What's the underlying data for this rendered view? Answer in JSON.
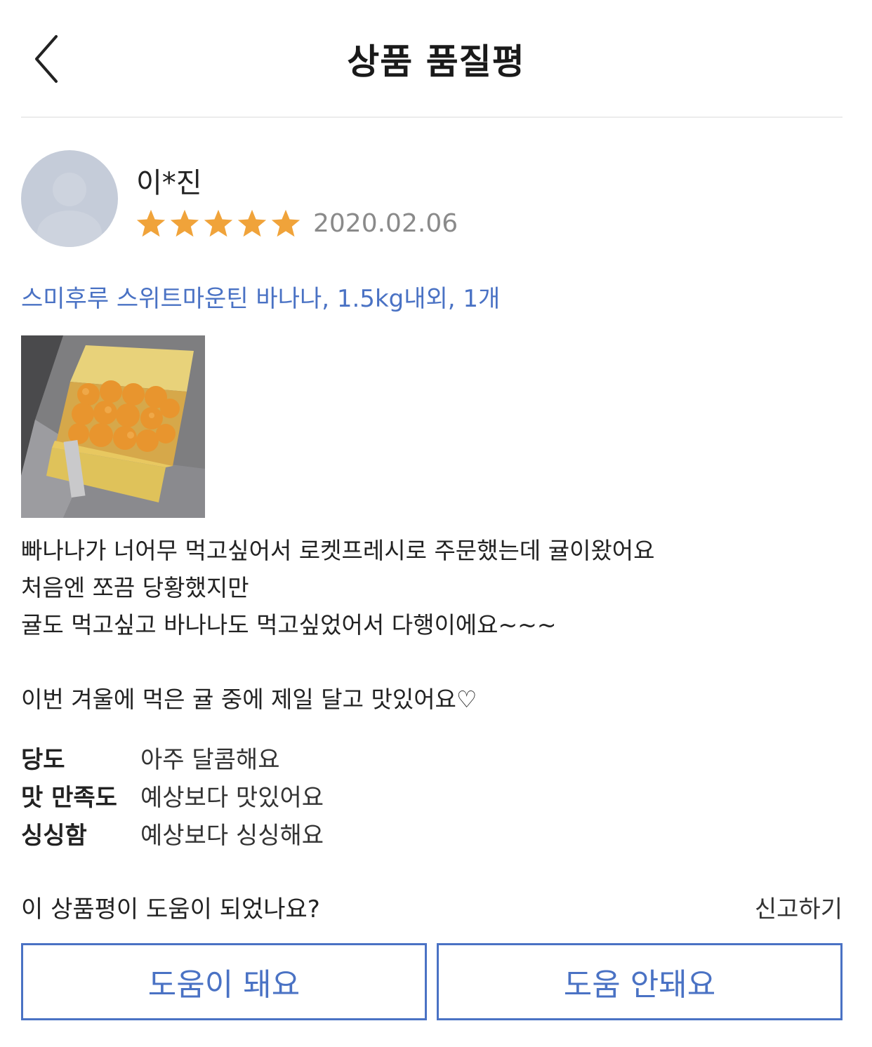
{
  "header": {
    "title": "상품 품질평",
    "back_icon": "chevron-left-icon"
  },
  "review": {
    "reviewer_name": "이*진",
    "rating_stars": 5,
    "rating_max": 5,
    "star_color": "#f0a33a",
    "date": "2020.02.06",
    "product_name": "스미후루 스위트마운틴 바나나, 1.5kg내외, 1개",
    "product_color": "#4a72c4",
    "body_lines": [
      "빠나나가 너어무 먹고싶어서 로켓프레시로 주문했는데 귤이왔어요",
      "처음엔 쪼끔 당황했지만",
      "귤도 먹고싶고 바나나도 먹고싶었어서 다행이에요~~~",
      "이번 겨울에 먹은 귤 중에 제일 달고 맛있어요♡"
    ],
    "ratings": [
      {
        "label": "당도",
        "value": "아주 달콤해요"
      },
      {
        "label": "맛 만족도",
        "value": "예상보다 맛있어요"
      },
      {
        "label": "싱싱함",
        "value": "예상보다 싱싱해요"
      }
    ]
  },
  "feedback": {
    "question": "이 상품평이 도움이 되었나요?",
    "report_label": "신고하기",
    "helpful_label": "도움이 돼요",
    "not_helpful_label": "도움 안돼요"
  }
}
